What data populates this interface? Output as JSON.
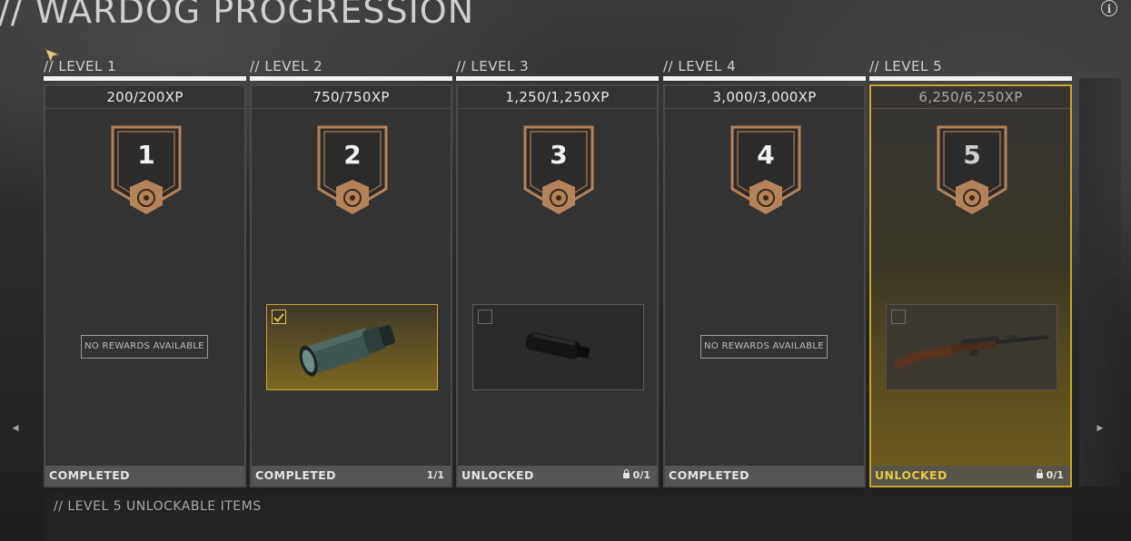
{
  "page": {
    "title": "// WARDOG PROGRESSION"
  },
  "colors": {
    "accent": "#c9a52a",
    "active_status": "#e8c840",
    "badge_bronze": "#b5835a"
  },
  "levels": [
    {
      "label": "// LEVEL 1",
      "xp": "200/200XP",
      "badge": "1",
      "reward": "NO REWARDS AVAILABLE",
      "status": "COMPLETED",
      "count": ""
    },
    {
      "label": "// LEVEL 2",
      "xp": "750/750XP",
      "badge": "2",
      "reward_icon": "scope-icon",
      "reward_owned": true,
      "status": "COMPLETED",
      "count": "1/1"
    },
    {
      "label": "// LEVEL 3",
      "xp": "1,250/1,250XP",
      "badge": "3",
      "reward_icon": "suppressor-icon",
      "reward_owned": false,
      "status": "UNLOCKED",
      "count": "0/1"
    },
    {
      "label": "// LEVEL 4",
      "xp": "3,000/3,000XP",
      "badge": "4",
      "reward": "NO REWARDS AVAILABLE",
      "status": "COMPLETED",
      "count": ""
    },
    {
      "label": "// LEVEL 5",
      "xp": "6,250/6,250XP",
      "badge": "5",
      "reward_icon": "rifle-icon",
      "reward_owned": false,
      "status": "UNLOCKED",
      "count": "0/1"
    }
  ],
  "bottom_panel": {
    "title": "// LEVEL 5 UNLOCKABLE ITEMS"
  }
}
